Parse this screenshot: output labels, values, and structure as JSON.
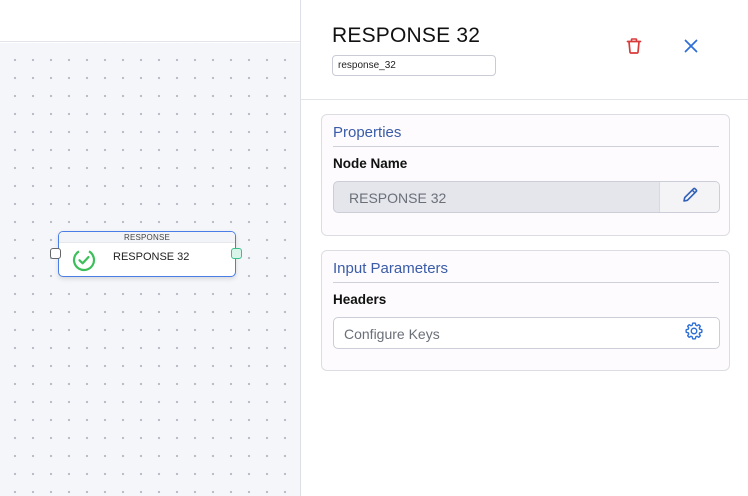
{
  "canvas": {
    "node": {
      "header": "RESPONSE",
      "label": "RESPONSE 32",
      "status_icon": "check-circle-icon"
    }
  },
  "panel": {
    "title": "RESPONSE 32",
    "node_id": "response_32",
    "actions": {
      "delete_icon": "trash-icon",
      "close_icon": "close-icon"
    },
    "properties": {
      "title": "Properties",
      "node_name_label": "Node Name",
      "node_name_value": "RESPONSE 32",
      "edit_icon": "pencil-icon"
    },
    "input_parameters": {
      "title": "Input Parameters",
      "headers_label": "Headers",
      "headers_placeholder": "Configure Keys",
      "settings_icon": "gear-icon"
    }
  },
  "colors": {
    "accent_blue": "#3a5ca8",
    "node_border": "#4a7ee6",
    "delete_red": "#d93a3a",
    "close_blue": "#2f6fd6",
    "success_green": "#3cbf5a"
  }
}
